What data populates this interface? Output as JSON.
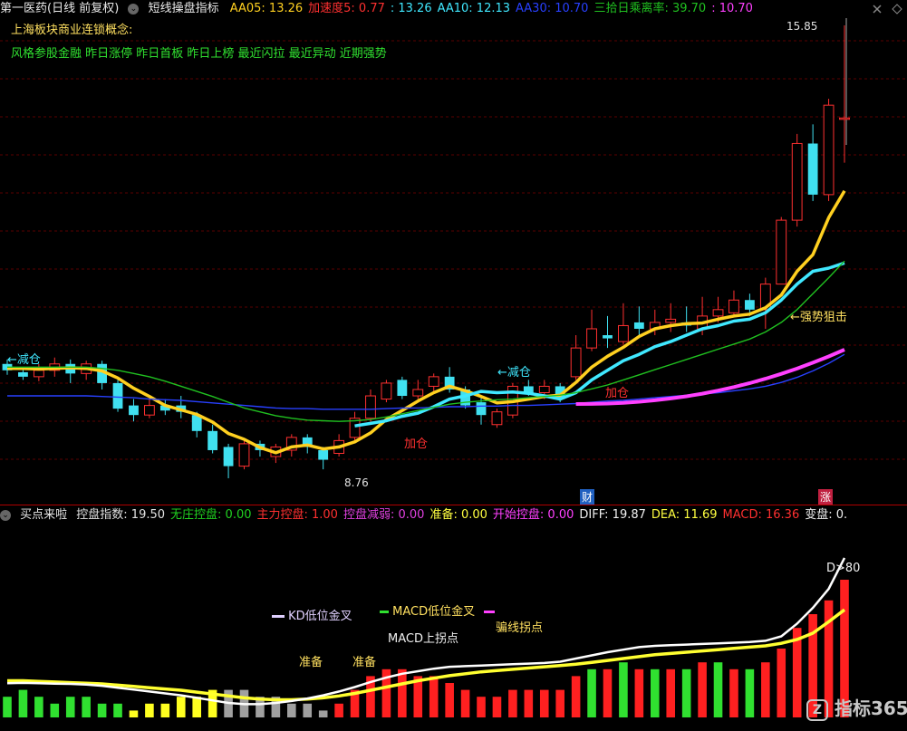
{
  "top": {
    "stock_name": "第一医药(日线 前复权)",
    "indicator_name": "短线操盘指标",
    "values": [
      {
        "label": "AA05: ",
        "value": "13.26",
        "color": "#ffd020"
      },
      {
        "label": "加速度5: ",
        "value": "0.77",
        "color": "#ff3030"
      },
      {
        "label": ": ",
        "value": "13.26",
        "color": "#40e8ff"
      },
      {
        "label": "AA10: ",
        "value": "12.13",
        "color": "#40e8ff"
      },
      {
        "label": "AA30: ",
        "value": "10.70",
        "color": "#2840ff"
      },
      {
        "label": "三拾日乘离率: ",
        "value": "39.70",
        "color": "#20c020"
      },
      {
        "label": ": ",
        "value": "10.70",
        "color": "#ff40ff"
      }
    ],
    "concept_title": "上海板块商业连锁概念:",
    "concepts": "风格参股金融 昨日涨停 昨日首板 昨日上榜 最近闪拉 最近异动 近期强势",
    "annotations": {
      "high": "15.85",
      "low": "8.76",
      "reduce1": "←减仓",
      "reduce2": "←减仓",
      "add1": "加仓",
      "add2": "加仓",
      "strong": "←强势狙击",
      "cai": "财",
      "zhang": "涨"
    }
  },
  "bottom": {
    "indicator_name": "买点来啦",
    "values": [
      {
        "label": "控盘指数: ",
        "value": "19.50",
        "color": "#e0e0e0"
      },
      {
        "label": "无庄控盘: ",
        "value": "0.00",
        "color": "#20d020"
      },
      {
        "label": "主力控盘: ",
        "value": "1.00",
        "color": "#ff3030"
      },
      {
        "label": "控盘减弱: ",
        "value": "0.00",
        "color": "#e040e0"
      },
      {
        "label": "准备: ",
        "value": "0.00",
        "color": "#ffff40"
      },
      {
        "label": "开始控盘: ",
        "value": "0.00",
        "color": "#ff40ff"
      },
      {
        "label": "DIFF: ",
        "value": "19.87",
        "color": "#f0f0f0"
      },
      {
        "label": "DEA: ",
        "value": "11.69",
        "color": "#ffff40"
      },
      {
        "label": "MACD: ",
        "value": "16.36",
        "color": "#ff3030"
      },
      {
        "label": "变盘: ",
        "value": "0.",
        "color": "#f0f0f0"
      }
    ],
    "annotations": {
      "d80": "D>80",
      "kd_cross": "KD低位金叉",
      "macd_cross": "MACD低位金叉",
      "macd_up": "MACD上拐点",
      "bias_turn": "骗线拐点",
      "prep1": "准备",
      "prep2": "准备"
    }
  },
  "watermark": "指标365",
  "chart_data": {
    "type": "candlestick",
    "ohlc": [
      [
        10.55,
        10.45,
        10.62,
        10.38
      ],
      [
        10.42,
        10.35,
        10.5,
        10.3
      ],
      [
        10.35,
        10.45,
        10.55,
        10.28
      ],
      [
        10.45,
        10.55,
        10.65,
        10.35
      ],
      [
        10.55,
        10.4,
        10.62,
        10.25
      ],
      [
        10.4,
        10.55,
        10.6,
        10.3
      ],
      [
        10.55,
        10.25,
        10.6,
        10.15
      ],
      [
        10.25,
        9.85,
        10.3,
        9.8
      ],
      [
        9.9,
        9.75,
        10.0,
        9.65
      ],
      [
        9.75,
        9.9,
        10.0,
        9.7
      ],
      [
        9.9,
        9.82,
        10.0,
        9.75
      ],
      [
        9.9,
        9.8,
        10.05,
        9.7
      ],
      [
        9.75,
        9.5,
        9.8,
        9.4
      ],
      [
        9.5,
        9.2,
        9.6,
        9.15
      ],
      [
        9.25,
        8.95,
        9.3,
        8.76
      ],
      [
        8.95,
        9.3,
        9.35,
        8.9
      ],
      [
        9.3,
        9.2,
        9.35,
        9.1
      ],
      [
        9.1,
        9.25,
        9.3,
        9.0
      ],
      [
        9.2,
        9.4,
        9.45,
        9.1
      ],
      [
        9.4,
        9.25,
        9.45,
        9.15
      ],
      [
        9.2,
        9.05,
        9.25,
        8.9
      ],
      [
        9.15,
        9.35,
        9.45,
        9.1
      ],
      [
        9.4,
        9.7,
        9.8,
        9.35
      ],
      [
        9.7,
        10.05,
        10.15,
        9.65
      ],
      [
        10.0,
        10.25,
        10.3,
        9.95
      ],
      [
        10.3,
        10.05,
        10.35,
        10.0
      ],
      [
        10.05,
        10.15,
        10.3,
        10.0
      ],
      [
        10.2,
        10.35,
        10.4,
        10.1
      ],
      [
        10.35,
        10.15,
        10.5,
        10.1
      ],
      [
        10.15,
        9.9,
        10.2,
        9.85
      ],
      [
        9.95,
        9.75,
        10.05,
        9.6
      ],
      [
        9.6,
        9.8,
        9.85,
        9.55
      ],
      [
        9.75,
        10.2,
        10.25,
        9.7
      ],
      [
        10.2,
        10.1,
        10.3,
        10.05
      ],
      [
        10.1,
        10.2,
        10.3,
        10.0
      ],
      [
        10.2,
        10.0,
        10.25,
        9.95
      ],
      [
        10.35,
        10.8,
        11.0,
        10.3
      ],
      [
        10.8,
        11.1,
        11.4,
        10.75
      ],
      [
        11.0,
        10.95,
        11.3,
        10.8
      ],
      [
        10.9,
        11.15,
        11.5,
        10.85
      ],
      [
        11.2,
        11.1,
        11.45,
        11.0
      ],
      [
        11.1,
        11.2,
        11.4,
        11.0
      ],
      [
        11.2,
        11.25,
        11.5,
        11.05
      ],
      [
        11.2,
        11.15,
        11.45,
        11.05
      ],
      [
        11.1,
        11.3,
        11.6,
        11.0
      ],
      [
        11.3,
        11.4,
        11.6,
        11.2
      ],
      [
        11.35,
        11.55,
        11.7,
        11.3
      ],
      [
        11.55,
        11.4,
        11.65,
        11.3
      ],
      [
        11.4,
        11.8,
        11.9,
        11.1
      ],
      [
        11.8,
        12.8,
        12.85,
        11.8
      ],
      [
        12.8,
        14.0,
        14.15,
        12.7
      ],
      [
        14.0,
        13.2,
        14.3,
        13.1
      ],
      [
        13.2,
        14.6,
        14.7,
        13.1
      ],
      [
        14.4,
        14.4,
        15.85,
        13.7
      ]
    ],
    "ma_lines": [
      {
        "name": "AA05",
        "color": "#ffd020",
        "values": [
          10.48,
          10.48,
          10.47,
          10.48,
          10.49,
          10.48,
          10.44,
          10.33,
          10.17,
          10.04,
          9.9,
          9.83,
          9.76,
          9.64,
          9.46,
          9.37,
          9.24,
          9.16,
          9.25,
          9.28,
          9.22,
          9.25,
          9.33,
          9.47,
          9.68,
          9.82,
          9.97,
          10.1,
          10.2,
          10.13,
          10.04,
          9.94,
          9.96,
          10.0,
          10.04,
          10.06,
          10.26,
          10.5,
          10.67,
          10.81,
          10.98,
          11.1,
          11.15,
          11.18,
          11.19,
          11.25,
          11.3,
          11.33,
          11.43,
          11.63,
          12.0,
          12.26,
          12.84,
          13.26
        ]
      },
      {
        "name": "AA10",
        "color": "#40e8ff",
        "values": [
          null,
          null,
          null,
          null,
          null,
          null,
          null,
          null,
          null,
          null,
          null,
          null,
          null,
          null,
          null,
          null,
          null,
          null,
          null,
          null,
          null,
          null,
          9.58,
          9.62,
          9.66,
          9.73,
          9.78,
          9.88,
          10.0,
          10.05,
          10.12,
          10.1,
          10.11,
          10.09,
          10.05,
          10.0,
          10.1,
          10.3,
          10.45,
          10.6,
          10.7,
          10.82,
          10.9,
          11.0,
          11.1,
          11.15,
          11.22,
          11.25,
          11.35,
          11.55,
          11.8,
          12.0,
          12.05,
          12.13
        ]
      },
      {
        "name": "AA30",
        "color": "#2840ff",
        "values": [
          10.05,
          10.05,
          10.05,
          10.05,
          10.05,
          10.05,
          10.04,
          10.03,
          10.02,
          10.0,
          9.99,
          9.98,
          9.96,
          9.94,
          9.92,
          9.9,
          9.88,
          9.86,
          9.85,
          9.85,
          9.84,
          9.84,
          9.84,
          9.84,
          9.85,
          9.86,
          9.86,
          9.87,
          9.88,
          9.88,
          9.89,
          9.89,
          9.9,
          9.9,
          9.91,
          9.92,
          9.93,
          9.95,
          9.97,
          9.98,
          10.0,
          10.02,
          10.04,
          10.06,
          10.08,
          10.1,
          10.13,
          10.16,
          10.2,
          10.26,
          10.34,
          10.44,
          10.56,
          10.7
        ]
      },
      {
        "name": "绿线",
        "color": "#20c020",
        "values": [
          10.5,
          10.5,
          10.5,
          10.5,
          10.5,
          10.5,
          10.48,
          10.45,
          10.4,
          10.35,
          10.28,
          10.2,
          10.12,
          10.04,
          9.95,
          9.86,
          9.8,
          9.74,
          9.7,
          9.67,
          9.66,
          9.65,
          9.66,
          9.68,
          9.72,
          9.77,
          9.82,
          9.87,
          9.92,
          9.95,
          9.97,
          9.99,
          10.0,
          10.02,
          10.04,
          10.06,
          10.1,
          10.16,
          10.22,
          10.3,
          10.38,
          10.46,
          10.54,
          10.62,
          10.7,
          10.78,
          10.86,
          10.94,
          11.05,
          11.2,
          11.4,
          11.65,
          11.9,
          12.16
        ]
      }
    ],
    "macd_hist": [
      3,
      4,
      3,
      2,
      3,
      3,
      2,
      2,
      -1,
      -2,
      -2,
      -3,
      -3,
      -4,
      -4,
      -4,
      -3,
      -3,
      -2,
      -2,
      -1,
      2,
      4,
      6,
      7,
      7,
      6,
      6,
      5,
      4,
      3,
      3,
      4,
      4,
      4,
      4,
      6,
      7,
      7,
      8,
      7,
      7,
      7,
      7,
      8,
      8,
      7,
      7,
      8,
      10,
      13,
      15,
      17,
      20
    ],
    "diff": [
      0.1,
      0.15,
      0.1,
      0.05,
      0.0,
      -0.1,
      -0.3,
      -0.6,
      -0.9,
      -1.2,
      -1.5,
      -1.8,
      -2.2,
      -2.6,
      -3.0,
      -3.2,
      -3.2,
      -3.0,
      -2.7,
      -2.3,
      -1.8,
      -1.2,
      -0.5,
      0.3,
      1.0,
      1.6,
      2.0,
      2.4,
      2.7,
      2.8,
      2.9,
      3.0,
      3.1,
      3.2,
      3.3,
      3.5,
      4.0,
      4.5,
      5.0,
      5.4,
      5.8,
      6.0,
      6.1,
      6.2,
      6.3,
      6.4,
      6.5,
      6.6,
      6.8,
      7.5,
      9.5,
      12.0,
      15.0,
      19.87
    ],
    "dea": [
      0.5,
      0.5,
      0.4,
      0.3,
      0.2,
      0.1,
      0.0,
      -0.2,
      -0.4,
      -0.6,
      -0.8,
      -1.0,
      -1.3,
      -1.6,
      -1.9,
      -2.2,
      -2.4,
      -2.5,
      -2.5,
      -2.4,
      -2.2,
      -1.9,
      -1.5,
      -1.0,
      -0.5,
      0.0,
      0.5,
      0.9,
      1.3,
      1.6,
      1.9,
      2.1,
      2.3,
      2.5,
      2.7,
      2.9,
      3.1,
      3.4,
      3.7,
      4.0,
      4.3,
      4.6,
      4.8,
      5.0,
      5.2,
      5.4,
      5.6,
      5.8,
      6.0,
      6.4,
      7.0,
      8.0,
      9.8,
      11.69
    ]
  }
}
